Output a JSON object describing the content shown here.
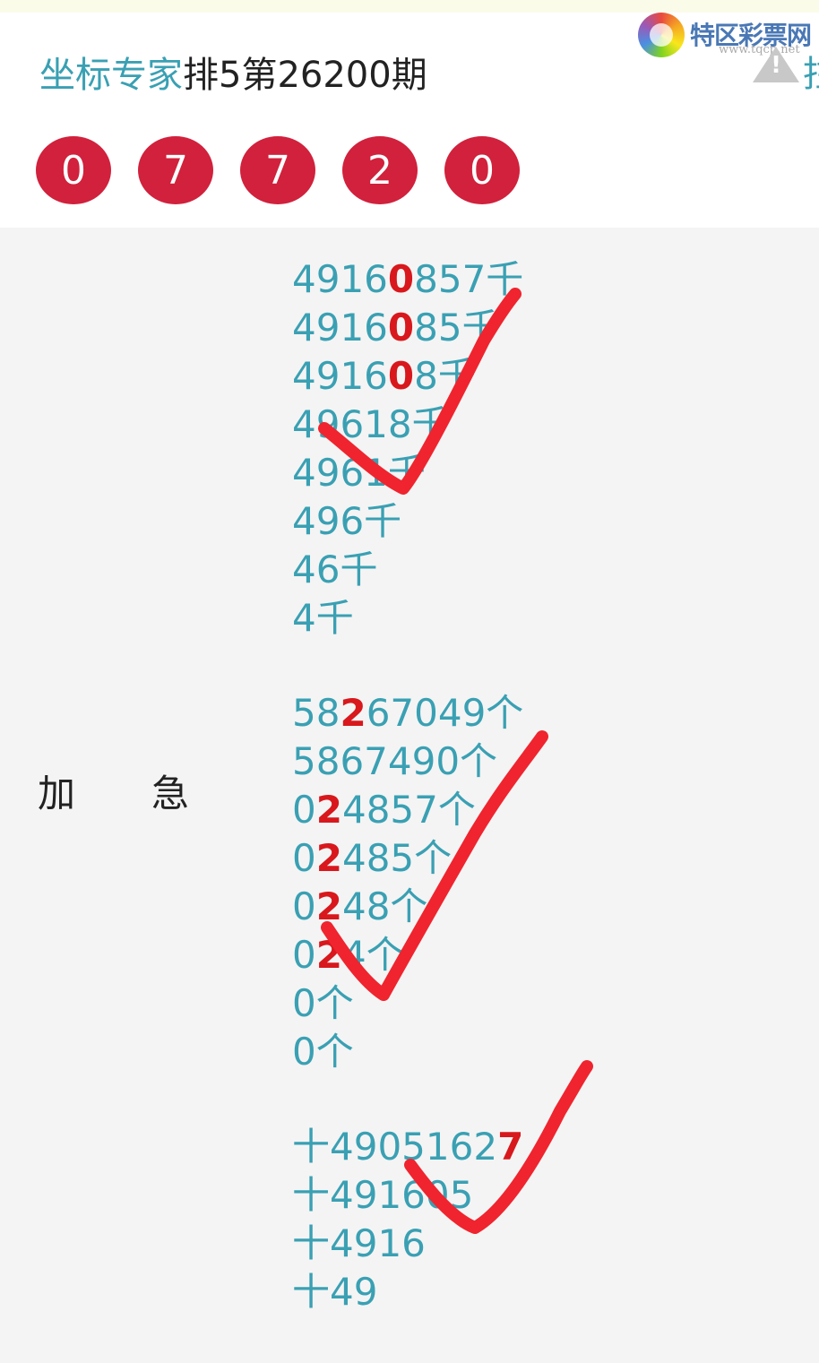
{
  "header": {
    "expert_label": "坐标专家",
    "issue_label": "排5第26200期",
    "balls": [
      "0",
      "7",
      "7",
      "2",
      "0"
    ],
    "brand_name": "特区彩票网",
    "brand_url": "www.tqcp.net",
    "edge_text": "拄"
  },
  "main": {
    "label_left": "加",
    "label_right": "急",
    "groups": [
      {
        "rows": [
          {
            "pre": "4916",
            "hl": "0",
            "post": "857千"
          },
          {
            "pre": "4916",
            "hl": "0",
            "post": "85千"
          },
          {
            "pre": "4916",
            "hl": "0",
            "post": "8千"
          },
          {
            "pre": "49618千",
            "hl": "",
            "post": ""
          },
          {
            "pre": "4961千",
            "hl": "",
            "post": ""
          },
          {
            "pre": "496千",
            "hl": "",
            "post": ""
          },
          {
            "pre": "46千",
            "hl": "",
            "post": ""
          },
          {
            "pre": "4千",
            "hl": "",
            "post": ""
          }
        ]
      },
      {
        "rows": [
          {
            "pre": "58",
            "hl": "2",
            "post": "67049个"
          },
          {
            "pre": "5867490个",
            "hl": "",
            "post": ""
          },
          {
            "pre": "0",
            "hl": "2",
            "post": "4857个"
          },
          {
            "pre": "0",
            "hl": "2",
            "post": "485个"
          },
          {
            "pre": "0",
            "hl": "2",
            "post": "48个"
          },
          {
            "pre": "0",
            "hl": "2",
            "post": "4个"
          },
          {
            "pre": "0个",
            "hl": "",
            "post": ""
          },
          {
            "pre": "0个",
            "hl": "",
            "post": ""
          }
        ]
      },
      {
        "rows": [
          {
            "pre": "十4905162",
            "hl": "7",
            "post": ""
          },
          {
            "pre": "十491605",
            "hl": "",
            "post": ""
          },
          {
            "pre": "十4916",
            "hl": "",
            "post": ""
          },
          {
            "pre": "十49",
            "hl": "",
            "post": ""
          }
        ]
      }
    ]
  },
  "colors": {
    "accent": "#3aa0b3",
    "ball": "#d1213c",
    "highlight": "#d8181c",
    "checkmark": "#f0242e"
  }
}
